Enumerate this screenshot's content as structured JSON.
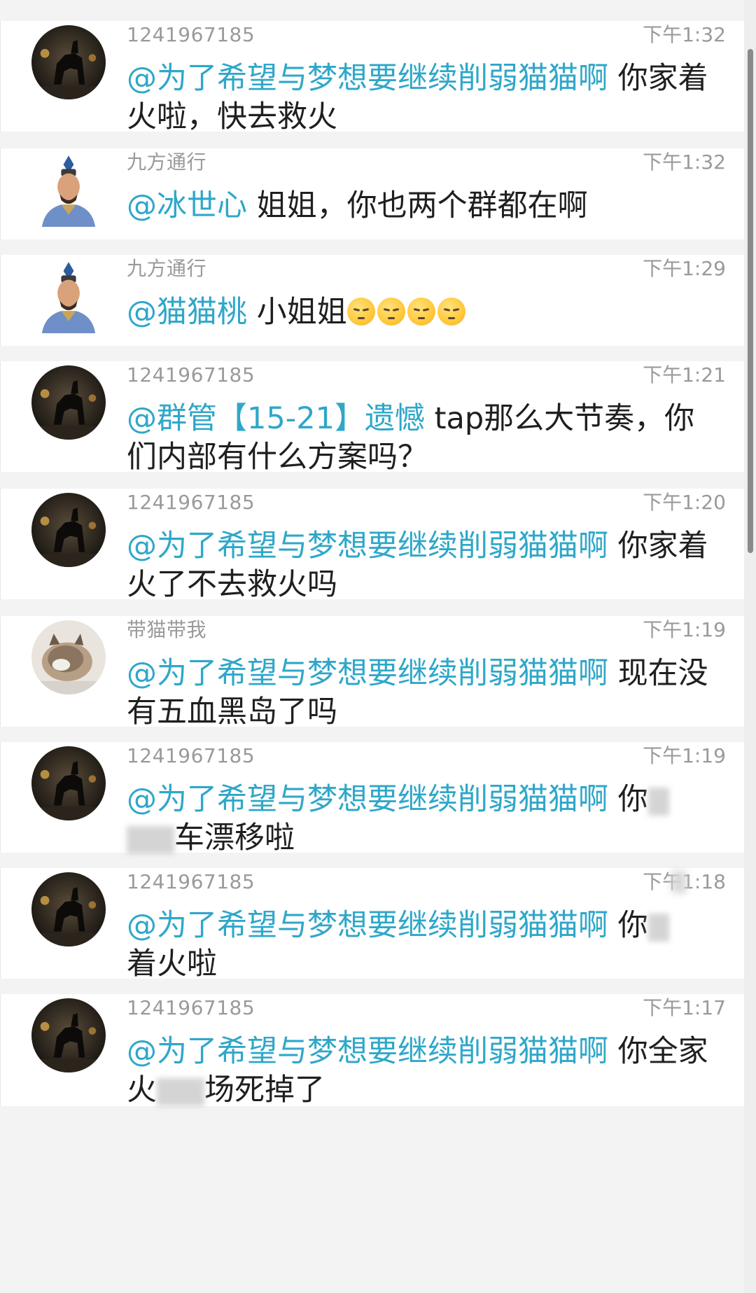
{
  "messages": [
    {
      "sender": "1241967185",
      "time": "下午1:32",
      "mention": "@为了希望与梦想要继续削弱猫猫啊",
      "text": " 你家着火啦，快去救火",
      "avatar": "dark-horse-statue-avatar"
    },
    {
      "sender": "九方通行",
      "time": "下午1:32",
      "mention": "@冰世心",
      "text": " 姐姐，你也两个群都在啊",
      "avatar": "warrior-avatar"
    },
    {
      "sender": "九方通行",
      "time": "下午1:29",
      "mention": "@猫猫桃",
      "text": " 小姐姐",
      "avatar": "warrior-avatar",
      "emoji_count": 4
    },
    {
      "sender": "1241967185",
      "time": "下午1:21",
      "mention": "@群管【15-21】遗憾",
      "text": " tap那么大节奏，你们内部有什么方案吗？",
      "avatar": "dark-horse-statue-avatar"
    },
    {
      "sender": "1241967185",
      "time": "下午1:20",
      "mention": "@为了希望与梦想要继续削弱猫猫啊",
      "text": " 你家着火了不去救火吗",
      "avatar": "dark-horse-statue-avatar"
    },
    {
      "sender": "带猫带我",
      "time": "下午1:19",
      "mention": "@为了希望与梦想要继续削弱猫猫啊",
      "text": " 现在没有五血黑岛了吗",
      "avatar": "cat-avatar"
    },
    {
      "sender": "1241967185",
      "time": "下午1:19",
      "mention": "@为了希望与梦想要继续削弱猫猫啊",
      "text_before_blur": " 你",
      "text_after_blur": "车漂移啦",
      "avatar": "dark-horse-statue-avatar"
    },
    {
      "sender": "1241967185",
      "time": "下午1:18",
      "mention": "@为了希望与梦想要继续削弱猫猫啊",
      "text_before_blur": " 你",
      "text_after_blur": "着火啦",
      "avatar": "dark-horse-statue-avatar"
    },
    {
      "sender": "1241967185",
      "time": "下午1:17",
      "mention": "@为了希望与梦想要继续削弱猫猫啊",
      "text_before_blur": " 你全家火",
      "text_after_blur": "场死掉了",
      "avatar": "dark-horse-statue-avatar"
    }
  ],
  "colors": {
    "mention": "#2fa7c9",
    "text": "#1f1f1f",
    "meta": "#9a9a9a",
    "background": "#f3f3f3",
    "card": "#ffffff"
  }
}
